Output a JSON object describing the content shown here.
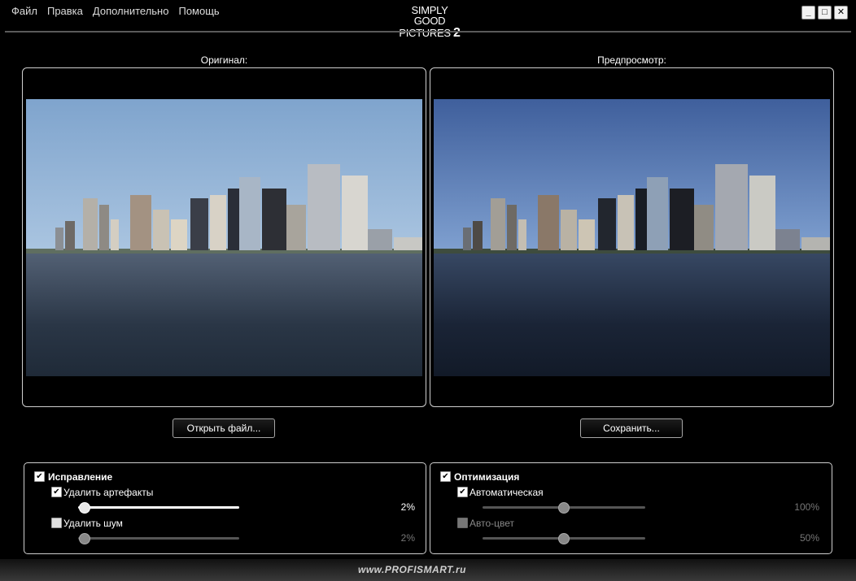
{
  "menu": [
    "Файл",
    "Правка",
    "Дополнительно",
    "Помощь"
  ],
  "logo": {
    "line1": "SIMPLY GOOD",
    "line2": "PICTURES",
    "number": "2"
  },
  "window_controls": {
    "minimize": "_",
    "maximize": "□",
    "close": "✕"
  },
  "original": {
    "caption": "Оригинал:"
  },
  "preview": {
    "caption": "Предпросмотр:"
  },
  "buttons": {
    "open": "Открыть файл...",
    "save": "Сохранить..."
  },
  "correction": {
    "title": "Исправление",
    "checked": true,
    "artifacts": {
      "label": "Удалить артефакты",
      "checked": true,
      "value_text": "2%",
      "level": 0.02
    },
    "noise": {
      "label": "Удалить шум",
      "checked": false,
      "value_text": "2%",
      "level": 0.02
    }
  },
  "optimization": {
    "title": "Оптимизация",
    "checked": true,
    "automatic": {
      "label": "Автоматическая",
      "checked": true,
      "value_text": "100%",
      "level": 0.5
    },
    "autocolor": {
      "label": "Авто-цвет",
      "checked": false,
      "value_text": "50%",
      "level": 0.5
    }
  },
  "watermark": "www.PROFISMART.ru",
  "colors": {
    "background": "#000000",
    "border": "#cfcfcf",
    "slider_track": "#555555"
  },
  "icons": {
    "check": "check-icon",
    "minimize": "minimize-icon",
    "maximize": "maximize-icon",
    "close": "close-icon"
  }
}
